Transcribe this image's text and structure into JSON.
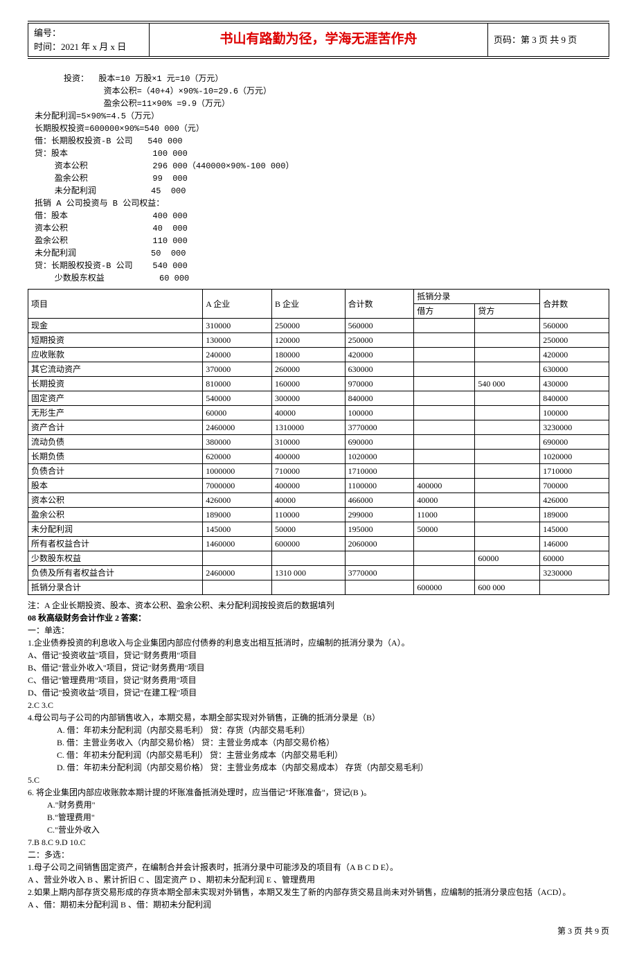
{
  "header": {
    "doc_no_label": "编号：",
    "time_label": "时间：2021 年 x 月 x 日",
    "center": "书山有路勤为径，学海无涯苦作舟",
    "page_label": "页码：第 3 页 共 9 页"
  },
  "calc": [
    "投资：  股本=10 万股×1 元=10（万元）",
    "        资本公积=（40+4）×90%-10=29.6（万元）",
    "        盈余公积=11×90% =9.9（万元）",
    "未分配利润=5×90%=4.5（万元）",
    "长期股权投资=600000×90%=540 000（元）",
    "借：长期股权投资-B 公司   540 000",
    "贷：股本                 100 000",
    "    资本公积             296 000（440000×90%-100 000）",
    "    盈余公积             99  000",
    "    未分配利润           45  000",
    "抵销 A 公司投资与 B 公司权益：",
    "借：股本                 400 000",
    "资本公积                 40  000",
    "盈余公积                 110 000",
    "未分配利润               50  000",
    "贷：长期股权投资-B 公司    540 000",
    "    少数股东权益           60 000"
  ],
  "table_header": {
    "item": "项目",
    "a": "A 企业",
    "b": "B 企业",
    "total": "合计数",
    "elim": "抵销分录",
    "debit": "借方",
    "credit": "贷方",
    "merged": "合并数"
  },
  "rows": [
    {
      "item": "现金",
      "a": "310000",
      "b": "250000",
      "total": "560000",
      "debit": "",
      "credit": "",
      "merged": "560000"
    },
    {
      "item": "短期投资",
      "a": "130000",
      "b": "120000",
      "total": "250000",
      "debit": "",
      "credit": "",
      "merged": "250000"
    },
    {
      "item": "应收账款",
      "a": "240000",
      "b": "180000",
      "total": "420000",
      "debit": "",
      "credit": "",
      "merged": "420000"
    },
    {
      "item": "其它流动资产",
      "a": "370000",
      "b": "260000",
      "total": "630000",
      "debit": "",
      "credit": "",
      "merged": "630000"
    },
    {
      "item": "长期投资",
      "a": "810000",
      "b": "160000",
      "total": "970000",
      "debit": "",
      "credit": "540 000",
      "merged": "430000"
    },
    {
      "item": "固定资产",
      "a": "540000",
      "b": "300000",
      "total": "840000",
      "debit": "",
      "credit": "",
      "merged": "840000"
    },
    {
      "item": "无形生产",
      "a": "60000",
      "b": "40000",
      "total": "100000",
      "debit": "",
      "credit": "",
      "merged": "100000"
    },
    {
      "item": "资产合计",
      "a": "2460000",
      "b": "1310000",
      "total": "3770000",
      "debit": "",
      "credit": "",
      "merged": "3230000"
    },
    {
      "item": "流动负债",
      "a": "380000",
      "b": "310000",
      "total": "690000",
      "debit": "",
      "credit": "",
      "merged": "690000"
    },
    {
      "item": "长期负债",
      "a": "620000",
      "b": "400000",
      "total": "1020000",
      "debit": "",
      "credit": "",
      "merged": "1020000"
    },
    {
      "item": "负债合计",
      "a": "1000000",
      "b": "710000",
      "total": "1710000",
      "debit": "",
      "credit": "",
      "merged": "1710000"
    },
    {
      "item": "股本",
      "a": "7000000",
      "b": "400000",
      "total": "1100000",
      "debit": "400000",
      "credit": "",
      "merged": "700000"
    },
    {
      "item": "资本公积",
      "a": "426000",
      "b": "40000",
      "total": "466000",
      "debit": "40000",
      "credit": "",
      "merged": "426000"
    },
    {
      "item": "盈余公积",
      "a": "189000",
      "b": "110000",
      "total": "299000",
      "debit": "11000",
      "credit": "",
      "merged": "189000"
    },
    {
      "item": "未分配利润",
      "a": "145000",
      "b": "50000",
      "total": "195000",
      "debit": "50000",
      "credit": "",
      "merged": "145000"
    },
    {
      "item": "所有者权益合计",
      "a": "1460000",
      "b": "600000",
      "total": "2060000",
      "debit": "",
      "credit": "",
      "merged": "146000"
    },
    {
      "item": "少数股东权益",
      "a": "",
      "b": "",
      "total": "",
      "debit": "",
      "credit": "60000",
      "merged": "60000"
    },
    {
      "item": "负债及所有者权益合计",
      "a": "2460000",
      "b": "1310 000",
      "total": "3770000",
      "debit": "",
      "credit": "",
      "merged": "3230000"
    },
    {
      "item": "抵销分录合计",
      "a": "",
      "b": "",
      "total": "",
      "debit": "600000",
      "credit": "600 000",
      "merged": ""
    }
  ],
  "note": "注：A 企业长期投资、股本、资本公积、盈余公积、未分配利润按投资后的数据填列",
  "hw_title": "08 秋高级财务会计作业 2 答案：",
  "sec1_title": "一：单选：",
  "q1": "1.企业债券投资的利息收入与企业集团内部应付债券的利息支出相互抵消时，应编制的抵消分录为（A）。",
  "q1a": "A、借记\"投资收益\"项目，贷记\"财务费用\"项目",
  "q1b": "B、借记\"营业外收入\"项目，贷记\"财务费用\"项目",
  "q1c": "C、借记\"管理费用\"项目，贷记\"财务费用\"项目",
  "q1d": "D、借记\"投资收益\"项目，贷记\"在建工程\"项目",
  "q23": "2.C     3.C",
  "q4": "4.母公司与子公司的内部销售收入，本期交易，本期全部实现对外销售，正确的抵消分录是（B）",
  "q4a": "A. 借：年初未分配利润（内部交易毛利）   贷：存货（内部交易毛利）",
  "q4b": "B. 借：主营业务收入（内部交易价格）   贷：主营业务成本（内部交易价格）",
  "q4c": "C. 借：年初未分配利润（内部交易毛利）   贷：主营业务成本（内部交易毛利）",
  "q4d": "D. 借：年初未分配利润（内部交易价格）   贷：主营业务成本（内部交易成本）  存货（内部交易毛利）",
  "q5": "5.C",
  "q6": "6. 将企业集团内部应收账款本期计提的坏账准备抵消处理时，应当借记\"坏账准备\"，贷记(B )。",
  "q6a": "A.\"财务费用\"",
  "q6b": "B.\"管理费用\"",
  "q6c": "C.\"营业外收入",
  "q7": "7.B     8.C     9.D    10.C",
  "sec2_title": "二：多选：",
  "mq1": "1.母子公司之间销售固定资产，在编制合并会计报表时，抵消分录中可能涉及的项目有（A B C D E）。",
  "mq1a": "A 、营业外收入 B 、累计折旧 C 、固定资产 D 、期初未分配利润 E 、管理费用",
  "mq2": "2.如果上期内部存货交易形成的存货本期全部未实现对外销售，本期又发生了新的内部存货交易且尚未对外销售，应编制的抵消分录应包括（ACD）。",
  "mq2a": "A 、借：期初未分配利润    B 、借：期初未分配利润",
  "footer": "第 3 页 共 9 页"
}
